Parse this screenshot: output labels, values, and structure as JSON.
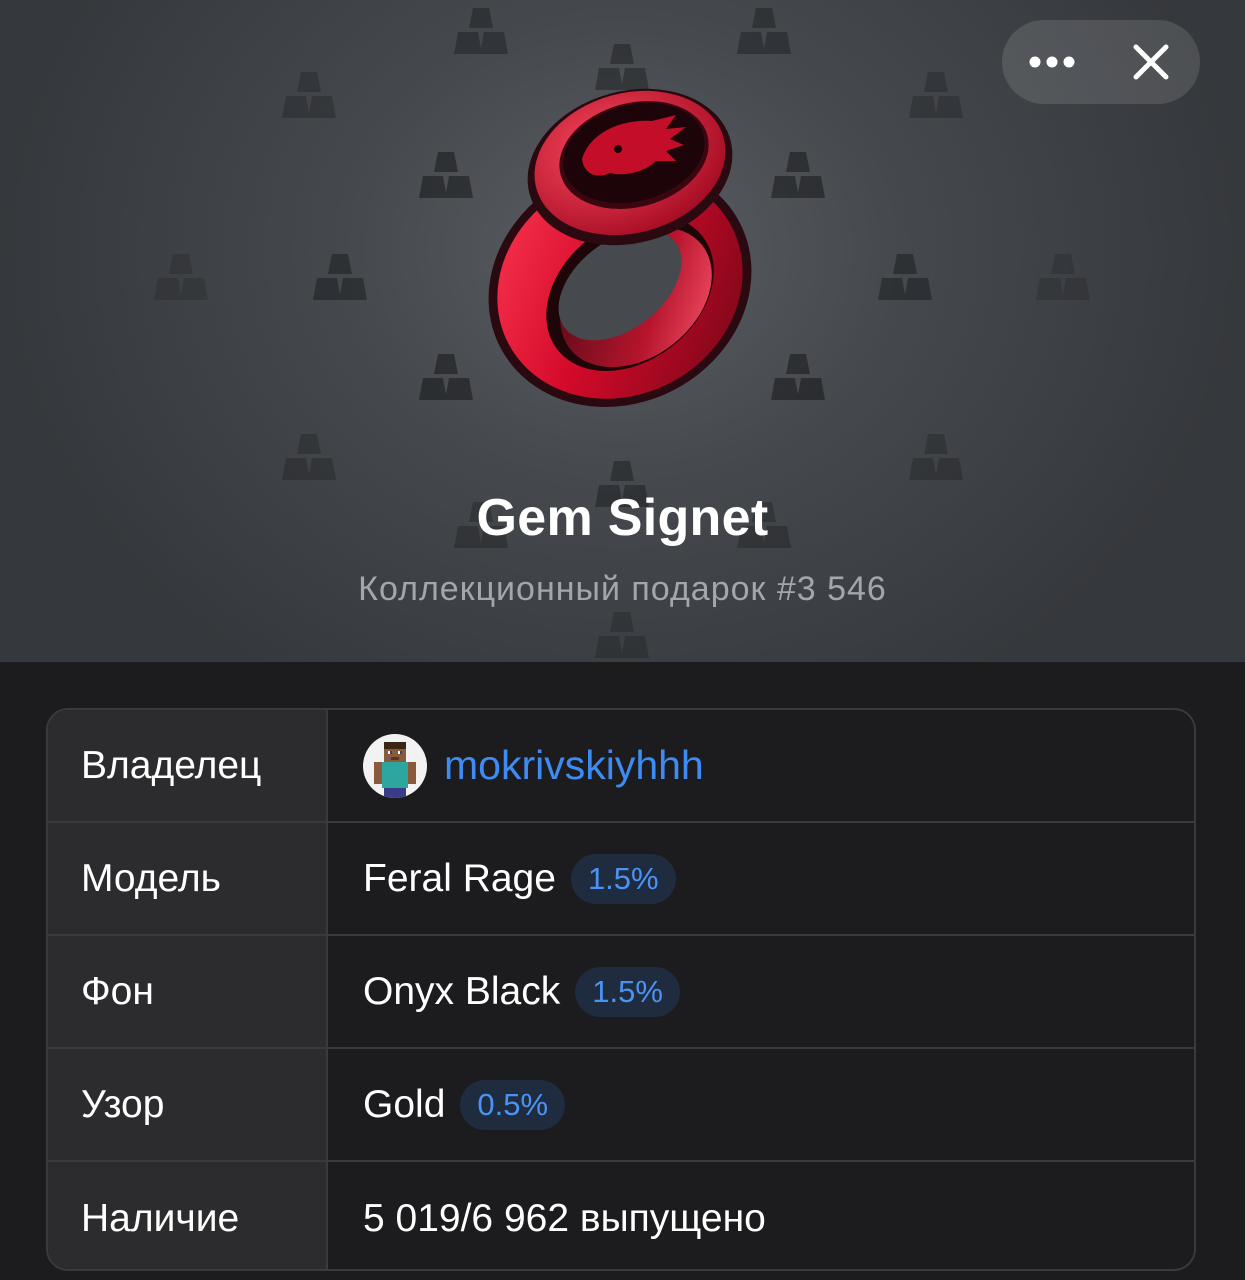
{
  "header": {
    "title": "Gem Signet",
    "subtitle": "Коллекционный подарок #3 546",
    "background_color": "#45494e",
    "ring_color": "#d8102e"
  },
  "toolbar": {
    "more_icon": "more-horizontal-icon",
    "close_icon": "close-icon"
  },
  "details": {
    "owner": {
      "label": "Владелец",
      "value": "mokrivskiyhhh",
      "link_color": "#3e8cf3"
    },
    "model": {
      "label": "Модель",
      "value": "Feral Rage",
      "rarity": "1.5%"
    },
    "backdrop": {
      "label": "Фон",
      "value": "Onyx Black",
      "rarity": "1.5%"
    },
    "symbol": {
      "label": "Узор",
      "value": "Gold",
      "rarity": "0.5%"
    },
    "availability": {
      "label": "Наличие",
      "value": "5 019/6 962 выпущено"
    }
  }
}
